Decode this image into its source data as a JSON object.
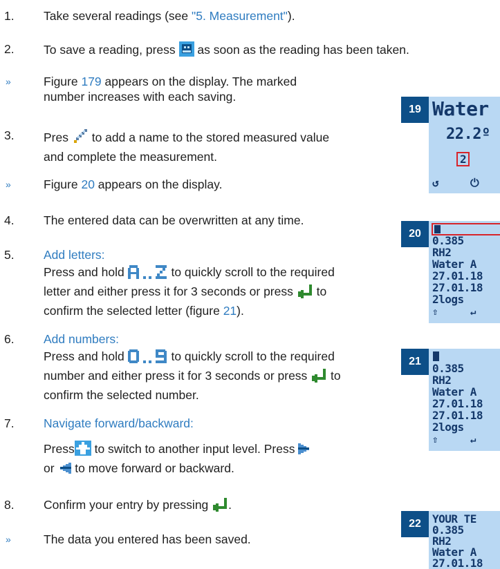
{
  "steps": [
    {
      "num": "1.",
      "text_pre": "Take several readings (see ",
      "link": "\"5. Measurement\"",
      "text_post": ")."
    },
    {
      "num": "2.",
      "text_pre": "To save a reading, press ",
      "text_post": " as soon as the reading has been taken.",
      "icon": "save-icon"
    },
    {
      "bullet": "»",
      "text_pre": "Figure ",
      "link": "179",
      "text_post": " appears on the display. The marked number increases with each saving."
    },
    {
      "num": "3.",
      "text_pre": "Pres ",
      "text_post": " to add a name to the stored measured value and complete the measurement.",
      "icon": "pencil-icon"
    },
    {
      "bullet": "»",
      "text_pre": "Figure ",
      "link": "20",
      "text_post": " appears on the display."
    },
    {
      "num": "4.",
      "text": "The entered data can be overwritten at any time."
    },
    {
      "num": "5.",
      "heading": "Add letters:",
      "text_pre": "Press and hold ",
      "text_mid": " to quickly scroll to the required letter and either press it for 3 seconds or press ",
      "text_mid2": " to confirm the selected letter (figure ",
      "link": "21",
      "text_post": ")."
    },
    {
      "num": "6.",
      "heading": "Add numbers:",
      "text_pre": "Press and hold ",
      "text_mid": " to quickly scroll to the required number and either press it for 3 seconds or press ",
      "text_post": " to confirm the selected number."
    },
    {
      "num": "7.",
      "heading": "Navigate  forward/backward:",
      "text_pre": "Press",
      "text_mid": " to switch to another input level. Press ",
      "text_mid2": "or ",
      "text_post": " to move forward or backward."
    },
    {
      "num": "8.",
      "text_pre": "Confirm your entry by pressing ",
      "text_post": "."
    },
    {
      "bullet": "»",
      "text": " The data you entered has been saved."
    }
  ],
  "figures": {
    "f19": {
      "badge": "19",
      "lines": [
        "Water",
        "22.2º",
        "2"
      ],
      "icons": [
        "↺",
        "⏻"
      ]
    },
    "f20": {
      "badge": "20",
      "lines": [
        "0.385",
        "RH2",
        "Water A",
        "27.01.18",
        "27.01.18",
        "2logs"
      ],
      "icons": [
        "⇧",
        "↵"
      ]
    },
    "f21": {
      "badge": "21",
      "lines": [
        "0.385",
        "RH2",
        "Water A",
        "27.01.18",
        "27.01.18",
        "2logs"
      ],
      "icons": [
        "⇧",
        "↵"
      ]
    },
    "f22": {
      "badge": "22",
      "lines": [
        "YOUR  TE",
        "0.385",
        "RH2",
        "Water A",
        "27.01.18"
      ]
    }
  },
  "colors": {
    "accent": "#2f7cc0",
    "badge": "#0d4f88",
    "lcd": "#b9d8f3"
  }
}
